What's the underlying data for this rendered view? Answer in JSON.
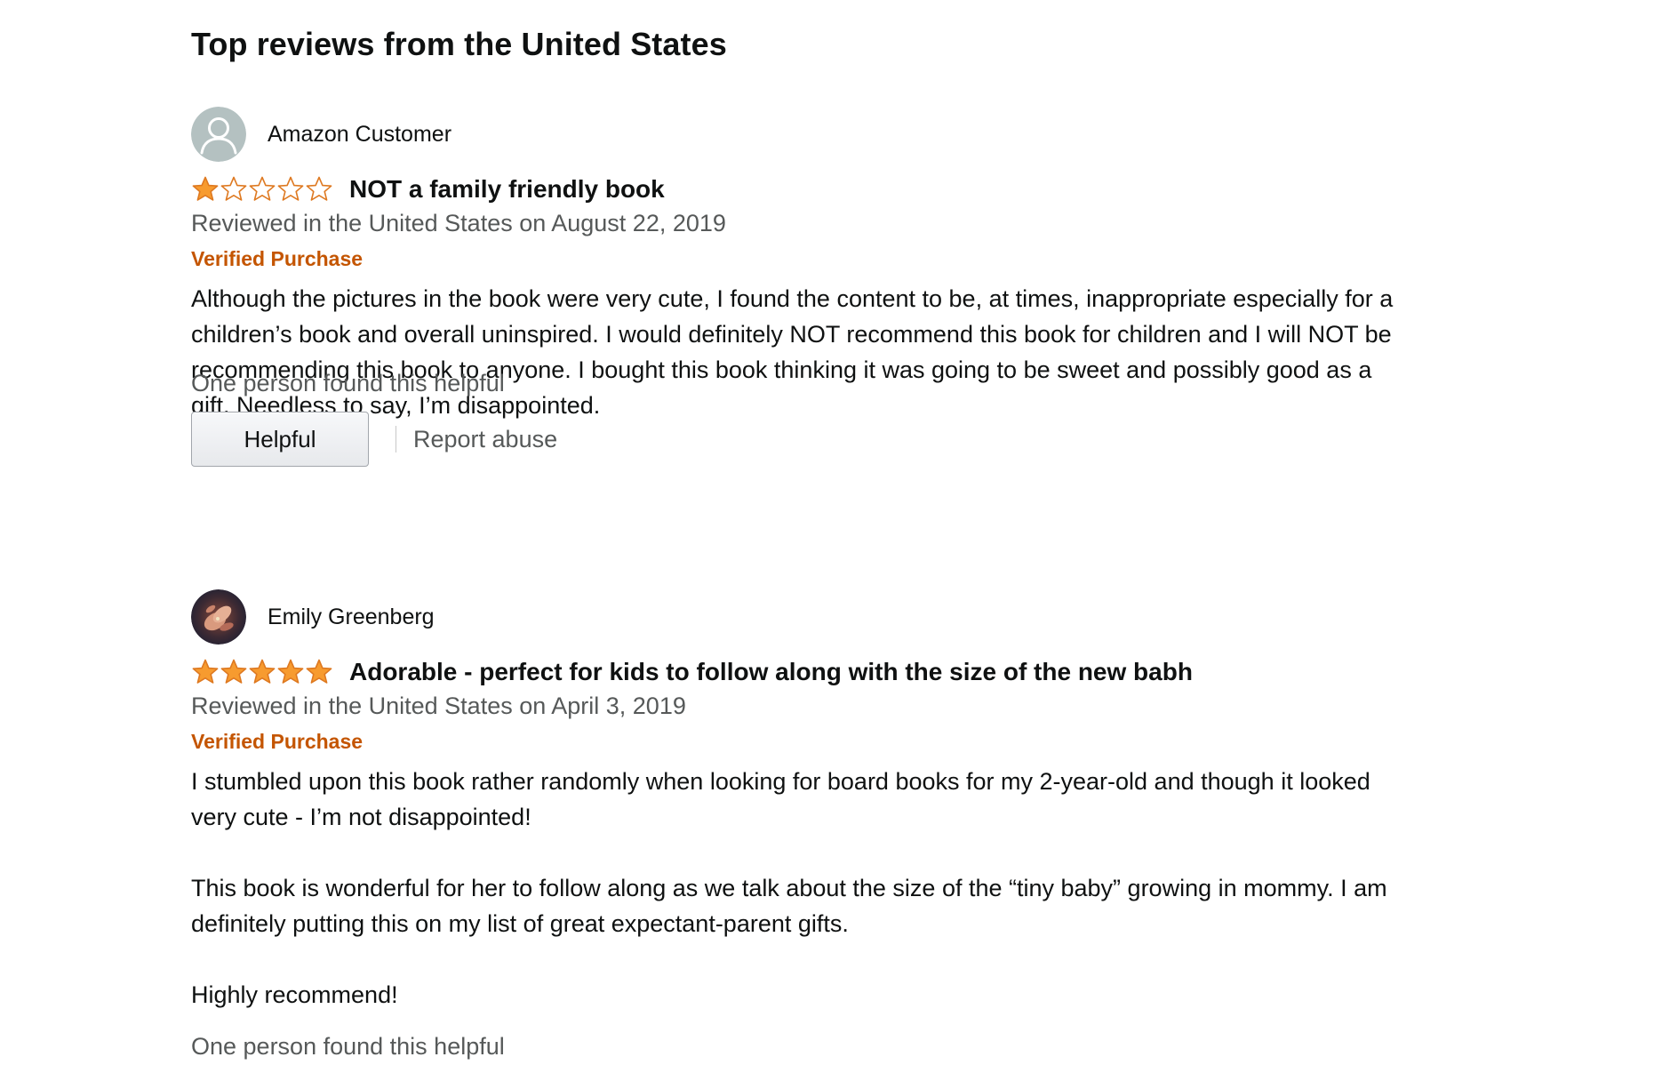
{
  "section": {
    "title": "Top reviews from the United States"
  },
  "colors": {
    "star_fill": "#f79b2f",
    "star_outline": "#de7921",
    "verified": "#c45500",
    "secondary_text": "#565959"
  },
  "reviews": [
    {
      "reviewer": {
        "name": "Amazon Customer",
        "avatar": "default-person-avatar-icon"
      },
      "rating": 1,
      "rating_max": 5,
      "title": "NOT a family friendly book",
      "date": "Reviewed in the United States on August 22, 2019",
      "verified_label": "Verified Purchase",
      "body": [
        "Although the pictures in the book were very cute, I found the content to be, at times, inappropriate especially for a children’s book and overall uninspired. I would definitely NOT recommend this book for children and I will NOT be recommending this book to anyone. I bought this book thinking it was going to be sweet and possibly good as a gift. Needless to say, I’m disappointed."
      ],
      "helpful_text": "One person found this helpful",
      "helpful_button": "Helpful",
      "report_label": "Report abuse"
    },
    {
      "reviewer": {
        "name": "Emily Greenberg",
        "avatar": "profile-photo-avatar"
      },
      "rating": 5,
      "rating_max": 5,
      "title": "Adorable - perfect for kids to follow along with the size of the new babh",
      "date": "Reviewed in the United States on April 3, 2019",
      "verified_label": "Verified Purchase",
      "body": [
        "I stumbled upon this book rather randomly when looking for board books for my 2-year-old and though it looked very cute - I’m not disappointed!",
        "This book is wonderful for her to follow along as we talk about the size of the “tiny baby” growing in mommy. I am definitely putting this on my list of great expectant-parent gifts.",
        "Highly recommend!"
      ],
      "helpful_text": "One person found this helpful"
    }
  ]
}
